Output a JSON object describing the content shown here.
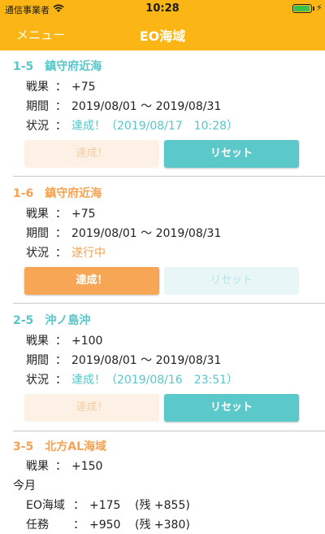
{
  "status_bar": {
    "carrier": "通信事業者",
    "time": "10:28",
    "wifi_icon": "wifi-icon",
    "battery_icon": "battery-icon",
    "battery_level": 1.0
  },
  "nav": {
    "menu_label": "メニュー",
    "title": "EO海域"
  },
  "labels": {
    "result": "戦果",
    "period": "期間",
    "status": "状況",
    "colon": "：",
    "this_month": "今月",
    "eo_area": "EO海域",
    "mission": "任務"
  },
  "cards": [
    {
      "area": "1-5",
      "name": "鎮守府近海",
      "result": "+75",
      "period": "2019/08/01 〜 2019/08/31",
      "status": "達成！（2019/08/17　10:28）",
      "achieve_label": "達成！",
      "reset_label": "リセット"
    },
    {
      "area": "1-6",
      "name": "鎮守府近海",
      "result": "+75",
      "period": "2019/08/01 〜 2019/08/31",
      "status": "遂行中",
      "achieve_label": "達成！",
      "reset_label": "リセット"
    },
    {
      "area": "2-5",
      "name": "沖ノ島沖",
      "result": "+100",
      "period": "2019/08/01 〜 2019/08/31",
      "status": "達成！（2019/08/16　23:51）",
      "achieve_label": "達成！",
      "reset_label": "リセット"
    }
  ],
  "summary": {
    "area": "3-5",
    "name": "北方AL海域",
    "result": "+150",
    "eo_value": "+175",
    "eo_remaining": "(残 +855)",
    "mission_value": "+950",
    "mission_remaining": "(残 +380)"
  },
  "colors": {
    "bar": "#fbb615",
    "accent_blue": "#58c6c8",
    "accent_orange": "#f5a352"
  }
}
